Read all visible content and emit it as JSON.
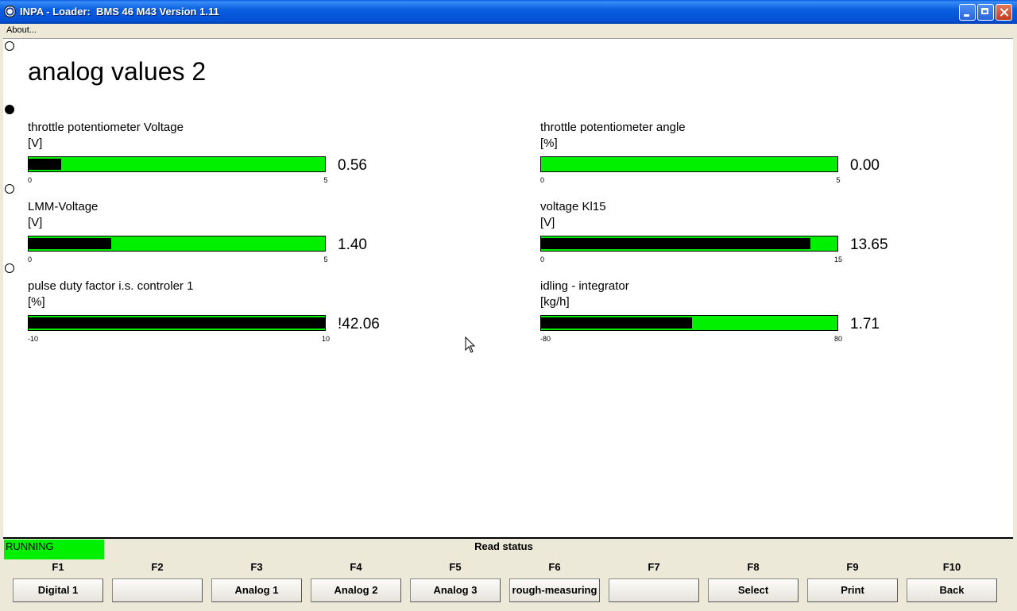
{
  "window": {
    "title": "INPA - Loader:  BMS 46 M43 Version 1.11"
  },
  "menu": {
    "about": "About..."
  },
  "main": {
    "heading": "analog values 2",
    "gauges": [
      {
        "label": "throttle potentiometer Voltage",
        "unit": "[V]",
        "min": "0",
        "max": "5",
        "value": "0.56",
        "fill_fraction": 0.11
      },
      {
        "label": "throttle potentiometer angle",
        "unit": "[%]",
        "min": "0",
        "max": "5",
        "value": "0.00",
        "fill_fraction": 0.0
      },
      {
        "label": "LMM-Voltage",
        "unit": "[V]",
        "min": "0",
        "max": "5",
        "value": "1.40",
        "fill_fraction": 0.28
      },
      {
        "label": "voltage Kl15",
        "unit": "[V]",
        "min": "0",
        "max": "15",
        "value": "13.65",
        "fill_fraction": 0.91
      },
      {
        "label": "pulse duty factor i.s. controler 1",
        "unit": "[%]",
        "min": "-10",
        "max": "10",
        "value": "!42.06",
        "fill_fraction": 1.0
      },
      {
        "label": "idling - integrator",
        "unit": "[kg/h]",
        "min": "-80",
        "max": "80",
        "value": "1.71",
        "fill_fraction": 0.51
      }
    ]
  },
  "status": {
    "badge": "RUNNING",
    "text": "Read status",
    "badge_color": "#00f000"
  },
  "function_keys": [
    {
      "key": "F1",
      "label": "Digital 1"
    },
    {
      "key": "F2",
      "label": ""
    },
    {
      "key": "F3",
      "label": "Analog 1"
    },
    {
      "key": "F4",
      "label": "Analog 2"
    },
    {
      "key": "F5",
      "label": "Analog 3"
    },
    {
      "key": "F6",
      "label": "rough-measuring"
    },
    {
      "key": "F7",
      "label": ""
    },
    {
      "key": "F8",
      "label": "Select"
    },
    {
      "key": "F9",
      "label": "Print"
    },
    {
      "key": "F10",
      "label": "Back"
    }
  ],
  "colors": {
    "bar": "#00f000",
    "fill": "#000000"
  }
}
